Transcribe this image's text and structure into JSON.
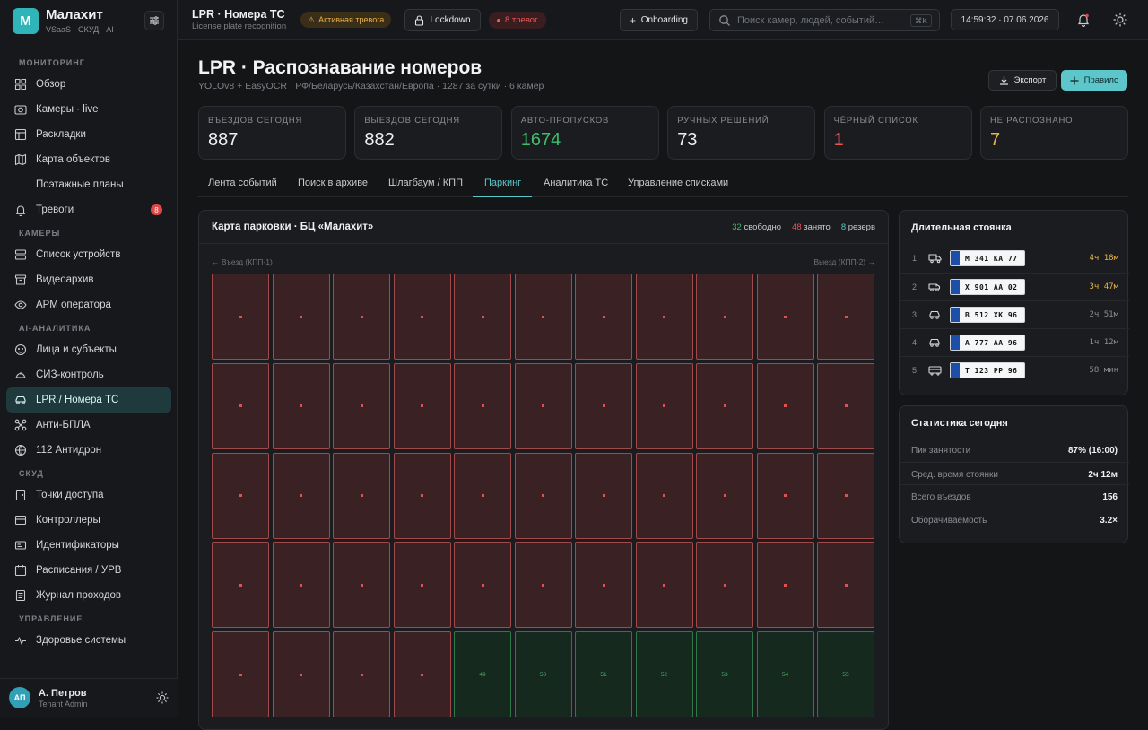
{
  "brand": {
    "logo_letter": "M",
    "name": "Малахит",
    "subtitle": "VSaaS · СКУД · AI"
  },
  "sidebar": {
    "sections": [
      {
        "title": "МОНИТОРИНГ",
        "items": [
          {
            "label": "Обзор",
            "icon": "grid-icon"
          },
          {
            "label": "Камеры · live",
            "icon": "camera-icon"
          },
          {
            "label": "Раскладки",
            "icon": "layout-icon"
          },
          {
            "label": "Карта объектов",
            "icon": "map-icon"
          },
          {
            "label": "Поэтажные планы",
            "icon": "none",
            "sub": true
          },
          {
            "label": "Тревоги",
            "icon": "bell-icon",
            "badge": "8"
          }
        ]
      },
      {
        "title": "КАМЕРЫ",
        "items": [
          {
            "label": "Список устройств",
            "icon": "devices-icon"
          },
          {
            "label": "Видеоархив",
            "icon": "archive-icon"
          },
          {
            "label": "АРМ оператора",
            "icon": "eye-icon"
          }
        ]
      },
      {
        "title": "AI-АНАЛИТИКА",
        "items": [
          {
            "label": "Лица и субъекты",
            "icon": "face-icon"
          },
          {
            "label": "СИЗ-контроль",
            "icon": "helmet-icon"
          },
          {
            "label": "LPR / Номера ТС",
            "icon": "car-icon",
            "active": true
          },
          {
            "label": "Анти-БПЛА",
            "icon": "drone-icon"
          },
          {
            "label": "112 Антидрон",
            "icon": "radar-icon"
          }
        ]
      },
      {
        "title": "СКУД",
        "items": [
          {
            "label": "Точки доступа",
            "icon": "door-icon"
          },
          {
            "label": "Контроллеры",
            "icon": "controller-icon"
          },
          {
            "label": "Идентификаторы",
            "icon": "card-icon"
          },
          {
            "label": "Расписания / УРВ",
            "icon": "calendar-icon"
          },
          {
            "label": "Журнал проходов",
            "icon": "journal-icon"
          }
        ]
      },
      {
        "title": "УПРАВЛЕНИЕ",
        "items": [
          {
            "label": "Здоровье системы",
            "icon": "pulse-icon"
          }
        ]
      }
    ]
  },
  "user": {
    "initials": "АП",
    "name": "А. Петров",
    "role": "Tenant Admin"
  },
  "topbar": {
    "title": "LPR · Номера ТС",
    "subtitle": "License plate recognition",
    "alert_label": "Активная тревога",
    "lockdown_label": "Lockdown",
    "alarms_label": "8 тревог",
    "onboarding_label": "Onboarding",
    "search_placeholder": "Поиск камер, людей, событий…",
    "search_kbd": "⌘K",
    "clock": "14:59:32 · 07.06.2026"
  },
  "page": {
    "title": "LPR · Распознавание номеров",
    "subtitle": "YOLOv8 + EasyOCR · РФ/Беларусь/Казахстан/Европа · 1287 за сутки · 6 камер",
    "export_label": "Экспорт",
    "rule_label": "Правило"
  },
  "kpis": [
    {
      "label": "ВЪЕЗДОВ СЕГОДНЯ",
      "value": "887",
      "color": "#f0f1f2"
    },
    {
      "label": "ВЫЕЗДОВ СЕГОДНЯ",
      "value": "882",
      "color": "#f0f1f2"
    },
    {
      "label": "АВТО-ПРОПУСКОВ",
      "value": "1674",
      "color": "#3fbf6a"
    },
    {
      "label": "РУЧНЫХ РЕШЕНИЙ",
      "value": "73",
      "color": "#f0f1f2"
    },
    {
      "label": "ЧЁРНЫЙ СПИСОК",
      "value": "1",
      "color": "#e85454"
    },
    {
      "label": "НЕ РАСПОЗНАНО",
      "value": "7",
      "color": "#e8b44a"
    }
  ],
  "tabs": [
    "Лента событий",
    "Поиск в архиве",
    "Шлагбаум / КПП",
    "Паркинг",
    "Аналитика ТС",
    "Управление списками"
  ],
  "active_tab": 3,
  "parking": {
    "title": "Карта парковки · БЦ «Малахит»",
    "free_count": "32",
    "free_label": "свободно",
    "occupied_count": "48",
    "occupied_label": "занято",
    "reserve_count": "8",
    "reserve_label": "резерв",
    "entry_label": "← Въезд (КПП-1)",
    "exit_label": "Выезд (КПП-2) →",
    "columns": 11,
    "visible_rows": 5,
    "occupied_spots": 48,
    "free_spot_labels": [
      "49",
      "50",
      "51",
      "52",
      "53",
      "54",
      "55"
    ],
    "colors": {
      "free": "#3fbf6a",
      "occupied": "#e85454",
      "reserve": "#5cc6cb"
    }
  },
  "long_stay": {
    "title": "Длительная стоянка",
    "rows": [
      {
        "n": "1",
        "vehicle": "truck-icon",
        "plate": "М 341 КА 77",
        "duration": "4ч 18м",
        "color": "#e8b44a"
      },
      {
        "n": "2",
        "vehicle": "van-icon",
        "plate": "Х 901 АА 02",
        "duration": "3ч 47м",
        "color": "#e8b44a"
      },
      {
        "n": "3",
        "vehicle": "car-icon",
        "plate": "В 512 ХК 96",
        "duration": "2ч 51м",
        "color": "#8a8d93"
      },
      {
        "n": "4",
        "vehicle": "car-icon",
        "plate": "А 777 АА 96",
        "duration": "1ч 12м",
        "color": "#8a8d93"
      },
      {
        "n": "5",
        "vehicle": "bus-icon",
        "plate": "Т 123 РР 96",
        "duration": "58 мин",
        "color": "#8a8d93"
      }
    ]
  },
  "stats": {
    "title": "Статистика сегодня",
    "rows": [
      {
        "label": "Пик занятости",
        "value": "87% (16:00)"
      },
      {
        "label": "Сред. время стоянки",
        "value": "2ч 12м"
      },
      {
        "label": "Всего въездов",
        "value": "156"
      },
      {
        "label": "Оборачиваемость",
        "value": "3.2×"
      }
    ]
  }
}
